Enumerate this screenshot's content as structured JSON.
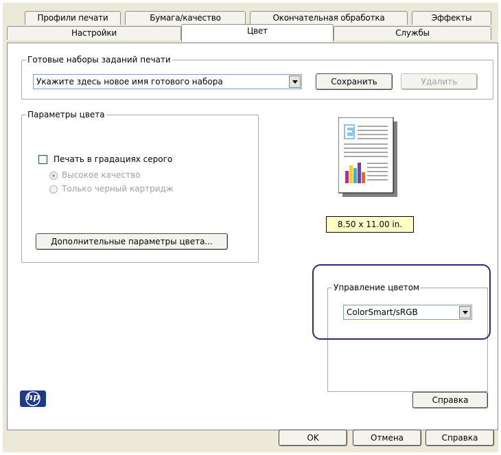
{
  "tabs_row1": [
    {
      "label": "Профили печати"
    },
    {
      "label": "Бумага/качество"
    },
    {
      "label": "Окончательная обработка"
    },
    {
      "label": "Эффекты"
    }
  ],
  "tabs_row2": [
    {
      "label": "Настройки"
    },
    {
      "label": "Цвет",
      "active": true
    },
    {
      "label": "Службы"
    }
  ],
  "presets": {
    "legend": "Готовые наборы заданий печати",
    "combo_value": "Укажите здесь новое имя готового набора",
    "save_label": "Сохранить",
    "delete_label": "Удалить"
  },
  "color_params": {
    "legend": "Параметры цвета",
    "grayscale_label": "Печать в градациях серого",
    "grayscale_checked": false,
    "option_high_quality": "Высокое качество",
    "option_black_only": "Только черный картридж",
    "advanced_button": "Дополнительные параметры цвета..."
  },
  "preview": {
    "paper_size": "8.50 x 11.00 in."
  },
  "color_management": {
    "legend": "Управление цветом",
    "value": "ColorSmart/sRGB"
  },
  "panel_help_label": "Справка",
  "footer": {
    "ok_label": "OK",
    "cancel_label": "Отмена",
    "help_label": "Справка"
  },
  "logo_text": "hp",
  "colors": {
    "highlight": "#2e2a6e",
    "paper_size_bg": "#ffffc4",
    "hp_logo": "#1d3a8a"
  }
}
